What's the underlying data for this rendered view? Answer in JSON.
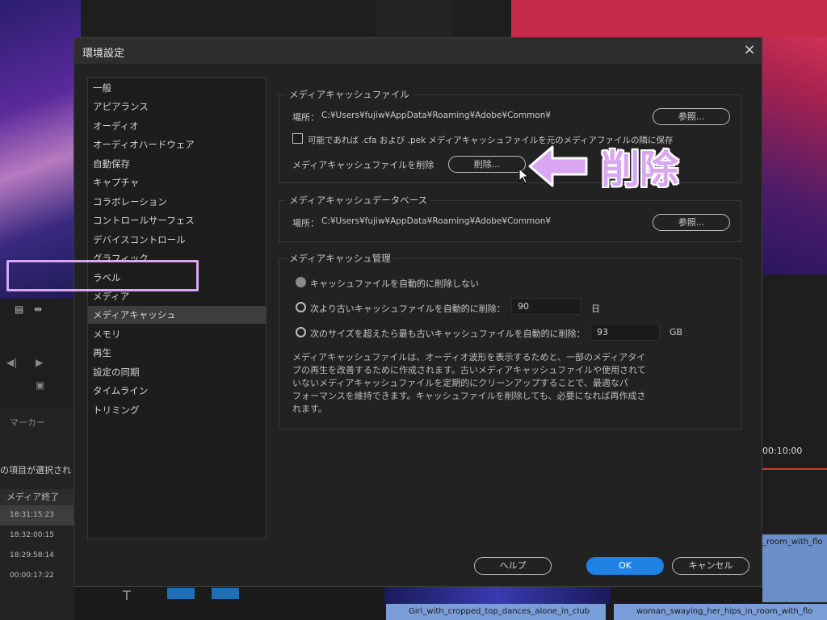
{
  "background": {
    "marker_tab": "マーカー",
    "selection_text": "の項目が選択され",
    "list_header": "メディア終了",
    "rows": [
      "18:31:15:23",
      "18:32:00:15",
      "18:29:58:14",
      "00:00:17:22"
    ],
    "timecode": "00:10:00",
    "clip_right": "_room_with_flo",
    "clip_bottom_1": "Girl_with_cropped_top_dances_alone_in_club",
    "clip_bottom_2": "woman_swaying_her_hips_in_room_with_flo"
  },
  "dialog": {
    "title": "環境設定",
    "close_icon": "×"
  },
  "sidebar": {
    "items": [
      {
        "label": "一般"
      },
      {
        "label": "アピアランス"
      },
      {
        "label": "オーディオ"
      },
      {
        "label": "オーディオハードウェア"
      },
      {
        "label": "自動保存"
      },
      {
        "label": "キャプチャ"
      },
      {
        "label": "コラボレーション"
      },
      {
        "label": "コントロールサーフェス"
      },
      {
        "label": "デバイスコントロール"
      },
      {
        "label": "グラフィック"
      },
      {
        "label": "ラベル"
      },
      {
        "label": "メディア"
      },
      {
        "label": "メディアキャッシュ",
        "active": true
      },
      {
        "label": "メモリ"
      },
      {
        "label": "再生"
      },
      {
        "label": "設定の同期"
      },
      {
        "label": "タイムライン"
      },
      {
        "label": "トリミング"
      }
    ]
  },
  "cache_files": {
    "legend": "メディアキャッシュファイル",
    "location_label": "場所：",
    "location_path": "C:¥Users¥fujiw¥AppData¥Roaming¥Adobe¥Common¥",
    "browse_label": "参照...",
    "checkbox_label": "可能であれば .cfa および .pek メディアキャッシュファイルを元のメディアファイルの隣に保存",
    "checkbox_checked": false,
    "delete_label_text": "メディアキャッシュファイルを削除",
    "delete_button": "削除..."
  },
  "cache_db": {
    "legend": "メディアキャッシュデータベース",
    "location_label": "場所：",
    "location_path": "C:¥Users¥fujiw¥AppData¥Roaming¥Adobe¥Common¥",
    "browse_label": "参照..."
  },
  "cache_management": {
    "legend": "メディアキャッシュ管理",
    "option_none": "キャッシュファイルを自動的に削除しない",
    "option_older": "次より古いキャッシュファイルを自動的に削除：",
    "older_value": "90",
    "older_unit": "日",
    "option_size": "次のサイズを超えたら最も古いキャッシュファイルを自動的に削除：",
    "size_value": "93",
    "size_unit": "GB",
    "description": [
      "メディアキャッシュファイルは、オーディオ波形を表示するためと、一部のメディアタイ",
      "プの再生を改善するために作成されます。古いメディアキャッシュファイルや使用されて",
      "いないメディアキャッシュファイルを定期的にクリーンアップすることで、最適なパ",
      "フォーマンスを維持できます。キャッシュファイルを削除しても、必要になれば再作成さ",
      "れます。"
    ]
  },
  "footer": {
    "help": "ヘルプ",
    "ok": "OK",
    "cancel": "キャンセル"
  },
  "annotation": {
    "text": "削除",
    "color": "#d9a6f2"
  }
}
